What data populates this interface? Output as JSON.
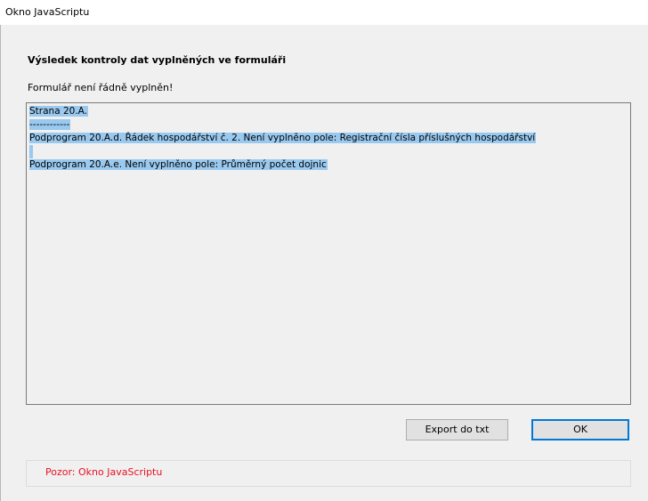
{
  "window": {
    "title": "Okno JavaScriptu"
  },
  "dialog": {
    "heading": "Výsledek kontroly dat vyplněných ve formuláři",
    "message": "Formulář není řádně vyplněn!"
  },
  "textarea": {
    "lines": [
      "Strana 20.A.",
      "------------",
      "Podprogram 20.A.d. Řádek hospodářství č. 2. Není vyplněno pole: Registrační čísla příslušných hospodářství",
      "",
      "Podprogram 20.A.e. Není vyplněno pole: Průměrný počet dojnic"
    ],
    "selection_color": "#99c9ef"
  },
  "buttons": {
    "export_label": "Export do txt",
    "ok_label": "OK"
  },
  "footer": {
    "warning_text": "Pozor: Okno JavaScriptu",
    "warning_color": "#e81123"
  }
}
